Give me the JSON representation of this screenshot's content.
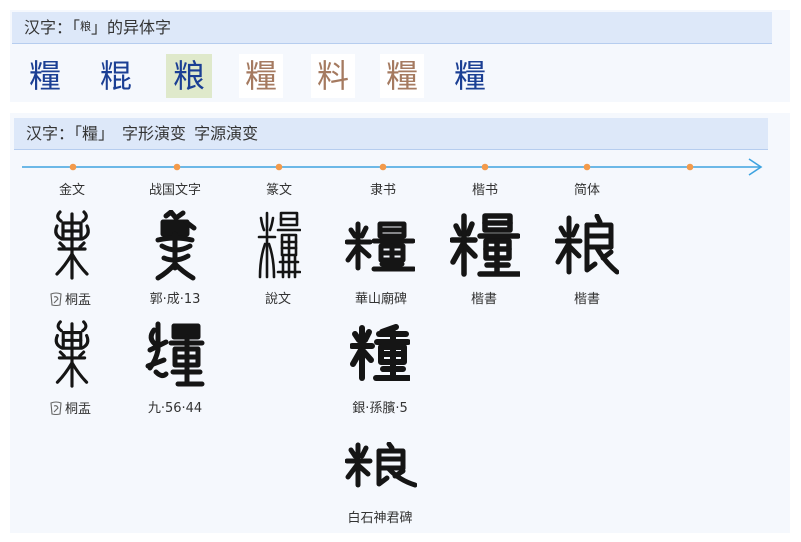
{
  "variants": {
    "header": {
      "prefix": "汉字：「",
      "char": "粮",
      "suffix": "」的异体字"
    },
    "items": [
      {
        "char": "糧"
      },
      {
        "char": "䊐"
      },
      {
        "char": "粮",
        "selected": true
      },
      {
        "char": "糧"
      },
      {
        "char": "料"
      },
      {
        "char": "糧"
      },
      {
        "char": "糧"
      }
    ]
  },
  "evolution": {
    "header": {
      "prefix": "汉字：「",
      "char": "糧",
      "suffix": "」",
      "glyph_evolution_title": "字形演变",
      "source_evolution_title": "字源演变"
    },
    "stages": [
      {
        "label": "金文",
        "items": [
          {
            "glyph": "糧",
            "caption": "桐盂",
            "source_icon": "bronze-inscription-icon"
          },
          {
            "glyph": "糧",
            "caption": "桐盂",
            "source_icon": "bronze-inscription-icon"
          }
        ]
      },
      {
        "label": "战国文字",
        "items": [
          {
            "glyph": "糧",
            "caption": "郭·成·13"
          },
          {
            "glyph": "糧",
            "caption": "九·56·44"
          }
        ]
      },
      {
        "label": "篆文",
        "items": [
          {
            "glyph": "糧",
            "caption": "說文"
          }
        ]
      },
      {
        "label": "隶书",
        "items": [
          {
            "glyph": "糧",
            "caption": "華山廟碑"
          },
          {
            "glyph": "糧",
            "caption": "銀·孫臏·5"
          },
          {
            "glyph": "粮",
            "caption": "白石神君碑"
          }
        ]
      },
      {
        "label": "楷书",
        "items": [
          {
            "glyph": "糧",
            "caption": "楷書"
          }
        ]
      },
      {
        "label": "简体",
        "items": [
          {
            "glyph": "粮",
            "caption": "楷書"
          }
        ]
      }
    ]
  },
  "colors": {
    "header_bg": "#dde8f9",
    "panel_bg": "#f5f8fd",
    "variant_text": "#1b3f94",
    "variant_image": "#a57a60",
    "selected_bg": "#dfe9cb",
    "timeline_line": "#3ea3e0",
    "timeline_dot": "#f39a4b"
  }
}
